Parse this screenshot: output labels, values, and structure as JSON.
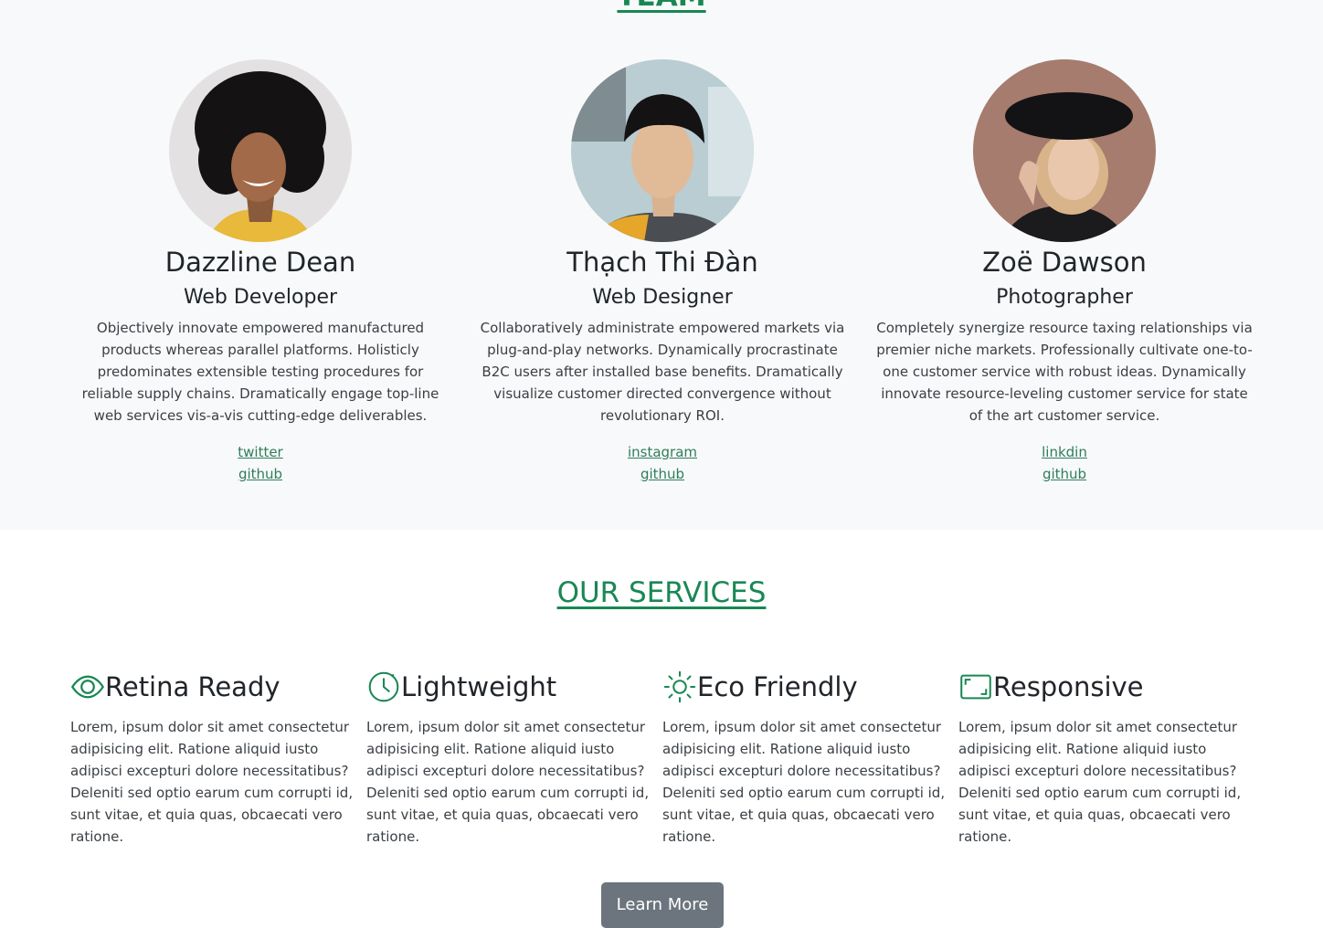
{
  "team": {
    "heading": "TEAM",
    "members": [
      {
        "name": "Dazzline Dean",
        "role": "Web Developer",
        "bio": "Objectively innovate empowered manufactured products whereas parallel platforms. Holisticly predominates extensible testing procedures for reliable supply chains. Dramatically engage top-line web services vis-a-vis cutting-edge deliverables.",
        "links": [
          "twitter",
          "github"
        ]
      },
      {
        "name": "Thạch Thi Đàn",
        "role": "Web Designer",
        "bio": "Collaboratively administrate empowered markets via plug-and-play networks. Dynamically procrastinate B2C users after installed base benefits. Dramatically visualize customer directed convergence without revolutionary ROI.",
        "links": [
          "instagram",
          "github"
        ]
      },
      {
        "name": "Zoë Dawson",
        "role": "Photographer",
        "bio": "Completely synergize resource taxing relationships via premier niche markets. Professionally cultivate one-to-one customer service with robust ideas. Dynamically innovate resource-leveling customer service for state of the art customer service.",
        "links": [
          "linkdin",
          "github"
        ]
      }
    ]
  },
  "services": {
    "heading": "OUR SERVICES",
    "items": [
      {
        "icon": "eye-icon",
        "title": "Retina Ready",
        "text": "Lorem, ipsum dolor sit amet consectetur adipisicing elit. Ratione aliquid iusto adipisci excepturi dolore necessitatibus? Deleniti sed optio earum cum corrupti id, sunt vitae, et quia quas, obcaecati vero ratione."
      },
      {
        "icon": "stopwatch-icon",
        "title": "Lightweight",
        "text": "Lorem, ipsum dolor sit amet consectetur adipisicing elit. Ratione aliquid iusto adipisci excepturi dolore necessitatibus? Deleniti sed optio earum cum corrupti id, sunt vitae, et quia quas, obcaecati vero ratione."
      },
      {
        "icon": "sun-icon",
        "title": "Eco Friendly",
        "text": "Lorem, ipsum dolor sit amet consectetur adipisicing elit. Ratione aliquid iusto adipisci excepturi dolore necessitatibus? Deleniti sed optio earum cum corrupti id, sunt vitae, et quia quas, obcaecati vero ratione."
      },
      {
        "icon": "fullscreen-icon",
        "title": "Responsive",
        "text": "Lorem, ipsum dolor sit amet consectetur adipisicing elit. Ratione aliquid iusto adipisci excepturi dolore necessitatibus? Deleniti sed optio earum cum corrupti id, sunt vitae, et quia quas, obcaecati vero ratione."
      }
    ],
    "button_label": "Learn More"
  },
  "colors": {
    "accent_green": "#198754",
    "link_green": "#2f7d5b",
    "section_bg": "#f8f9fa",
    "button_gray": "#6c757d"
  }
}
